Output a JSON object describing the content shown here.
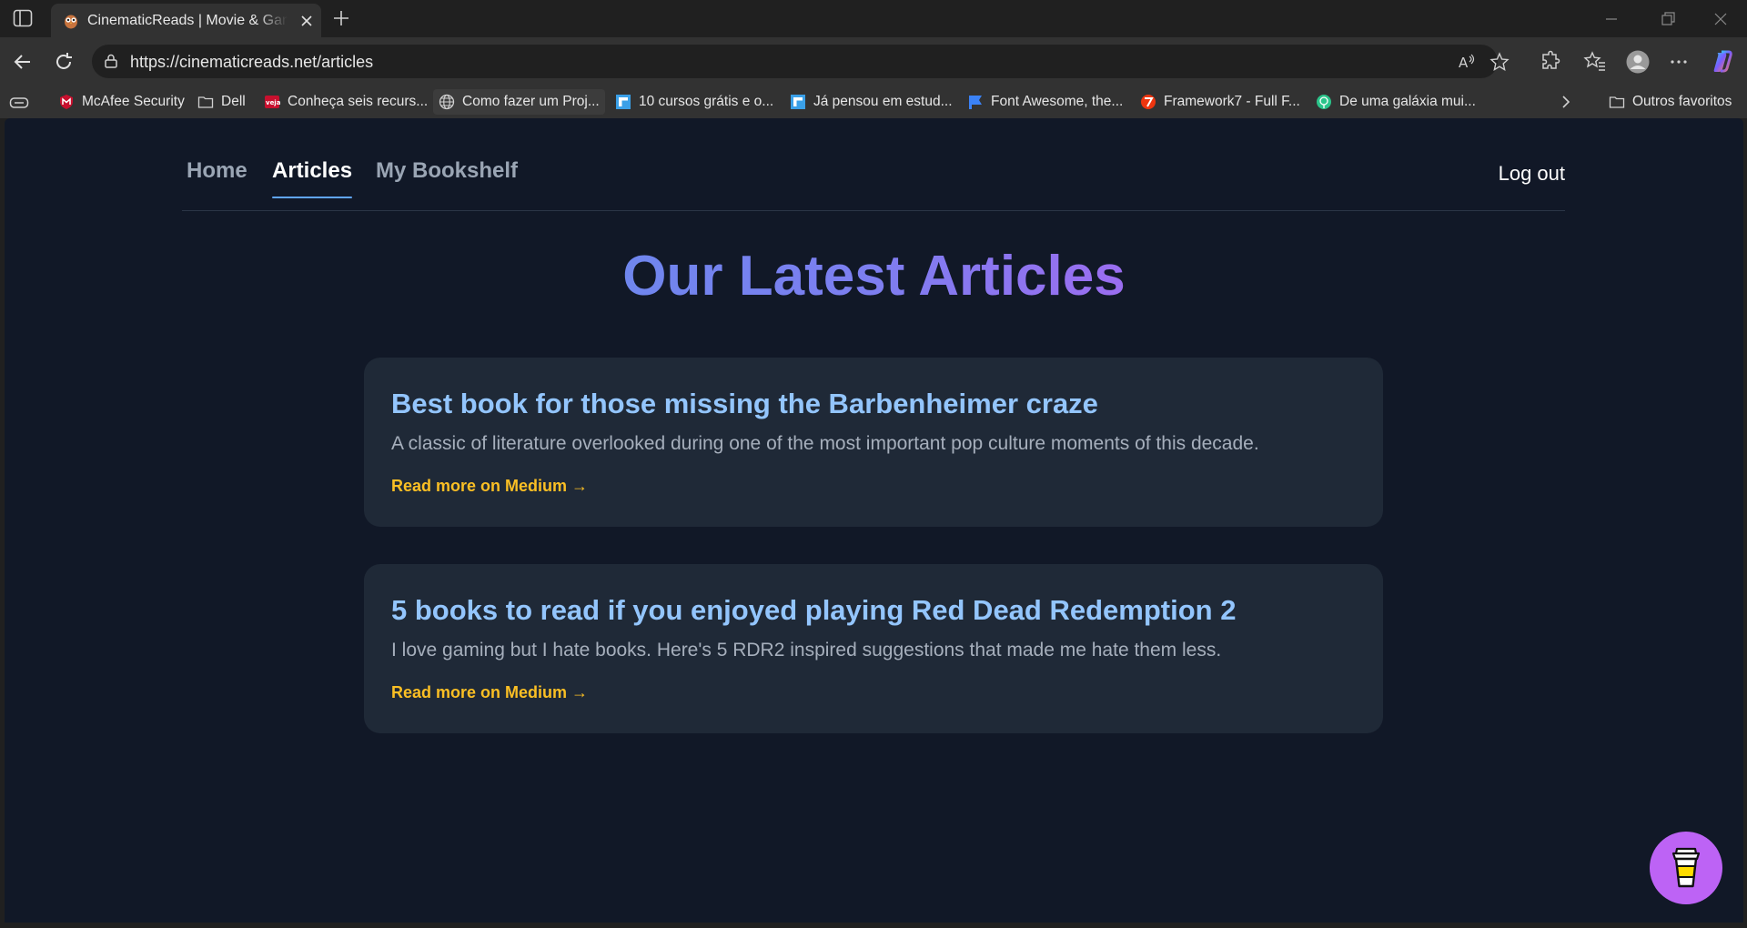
{
  "browser": {
    "tab_title": "CinematicReads | Movie & Game-Inspired Books",
    "url": "https://cinematicreads.net/articles",
    "bookmarks": [
      {
        "label": "McAfee Security",
        "icon": "mcafee-icon"
      },
      {
        "label": "Dell",
        "icon": "folder-icon"
      },
      {
        "label": "Conheça seis recurs...",
        "icon": "veja-icon"
      },
      {
        "label": "Como fazer um Proj...",
        "icon": "globe-icon"
      },
      {
        "label": "10 cursos grátis e o...",
        "icon": "flipboard-icon"
      },
      {
        "label": "Já pensou em estud...",
        "icon": "flipboard-icon"
      },
      {
        "label": "Font Awesome, the...",
        "icon": "flag-icon"
      },
      {
        "label": "Framework7 - Full F...",
        "icon": "framework7-icon"
      },
      {
        "label": "De uma galáxia mui...",
        "icon": "brain-icon"
      }
    ],
    "other_favorites": "Outros favoritos"
  },
  "nav": {
    "home": "Home",
    "articles": "Articles",
    "bookshelf": "My Bookshelf",
    "logout": "Log out",
    "active": "articles"
  },
  "page": {
    "title": "Our Latest Articles"
  },
  "articles": [
    {
      "title": "Best book for those missing the Barbenheimer craze",
      "description": "A classic of literature overlooked during one of the most important pop culture moments of this decade.",
      "link": "Read more on Medium →"
    },
    {
      "title": "5 books to read if you enjoyed playing Red Dead Redemption 2",
      "description": "I love gaming but I hate books. Here's 5 RDR2 inspired suggestions that made me hate them less.",
      "link": "Read more on Medium →"
    }
  ],
  "colors": {
    "background": "#111827",
    "card": "#1f2937",
    "card_title": "#93c5fd",
    "link": "#fbbf24",
    "fab": "#bd63f5"
  }
}
